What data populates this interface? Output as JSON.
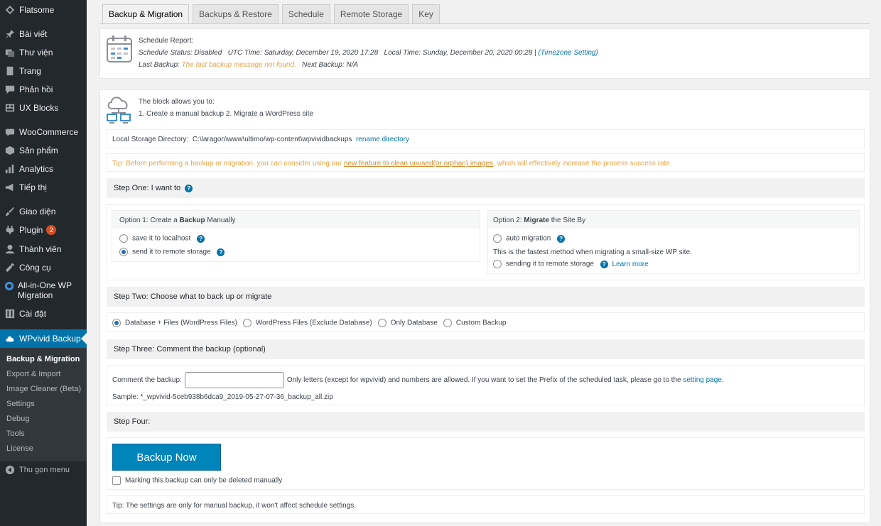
{
  "sidebar": {
    "site_name": "Flatsome",
    "items": [
      {
        "label": "Bài viết"
      },
      {
        "label": "Thư viện"
      },
      {
        "label": "Trang"
      },
      {
        "label": "Phản hồi"
      },
      {
        "label": "UX Blocks"
      },
      {
        "label": "WooCommerce"
      },
      {
        "label": "Sản phẩm"
      },
      {
        "label": "Analytics"
      },
      {
        "label": "Tiếp thị"
      },
      {
        "label": "Giao diện"
      },
      {
        "label": "Plugin",
        "badge": "2"
      },
      {
        "label": "Thành viên"
      },
      {
        "label": "Công cụ"
      },
      {
        "label": "All-in-One WP Migration"
      },
      {
        "label": "Cài đặt"
      },
      {
        "label": "WPvivid Backup"
      }
    ],
    "submenu": [
      "Backup & Migration",
      "Export & Import",
      "Image Cleaner (Beta)",
      "Settings",
      "Debug",
      "Tools",
      "License"
    ],
    "collapse_label": "Thu gọn menu"
  },
  "tabs": [
    "Backup & Migration",
    "Backups & Restore",
    "Schedule",
    "Remote Storage",
    "Key"
  ],
  "report": {
    "title": "Schedule Report:",
    "status_label": "Schedule Status:",
    "status_value": "Disabled",
    "utc_label": "UTC Time:",
    "utc_value": "Saturday, December 19, 2020 17:28",
    "local_label": "Local Time:",
    "local_value": "Sunday, December 20, 2020 00:28 |",
    "timezone_link": "(Timezone Setting)",
    "last_backup_label": "Last Backup:",
    "last_backup_value": "The last backup message not found.",
    "next_backup_label": "Next Backup:",
    "next_backup_value": "N/A"
  },
  "intro": {
    "line1": "The block allows you to:",
    "line2": "1. Create a manual backup   2. Migrate a WordPress site"
  },
  "storage": {
    "label": "Local Storage Directory:",
    "path": "C:\\laragon\\www\\ultimo/wp-content\\wpvividbackups",
    "rename_link": "rename directory"
  },
  "tip1": {
    "before": "Tip: Before performing a backup or migration, you can consider using our ",
    "link": "new feature to clean unused(or orphan) images",
    "after": ", which will effectively increase the process success rate."
  },
  "step1": {
    "title": "Step One: I want to",
    "option1_prefix": "Option 1:",
    "option1_a": " Create a ",
    "option1_bold": "Backup",
    "option1_b": " Manually",
    "save_local": "save it to localhost",
    "send_remote": "send it to remote storage",
    "option2_prefix": "Option 2:",
    "option2_bold": "Migrate",
    "option2_b": " the Site By",
    "auto_migration": "auto migration",
    "auto_desc": "This is the fastest method when migrating a small-size WP site.",
    "sending_remote": "sending it to remote storage",
    "learn_more": "Learn more"
  },
  "step2": {
    "title": "Step Two: Choose what to back up or migrate",
    "options": [
      "Database + Files (WordPress Files)",
      "WordPress Files (Exclude Database)",
      "Only Database",
      "Custom Backup"
    ]
  },
  "step3": {
    "title": "Step Three: Comment the backup (optional)",
    "comment_label": "Comment the backup:",
    "comment_value": "",
    "hint": "Only letters (except for wpvivid) and numbers are allowed. If you want to set the Prefix of the scheduled task, please go to the",
    "setting_link": "setting page",
    "sample": "Sample: *_wpvivid-5ceb938b6dca9_2019-05-27-07-36_backup_all.zip"
  },
  "step4": {
    "title": "Step Four:",
    "backup_button": "Backup Now",
    "marking_label": "Marking this backup can only be deleted manually"
  },
  "tip2": {
    "label": "Tip:",
    "text": "The settings are only for manual backup, it won't affect schedule settings."
  }
}
